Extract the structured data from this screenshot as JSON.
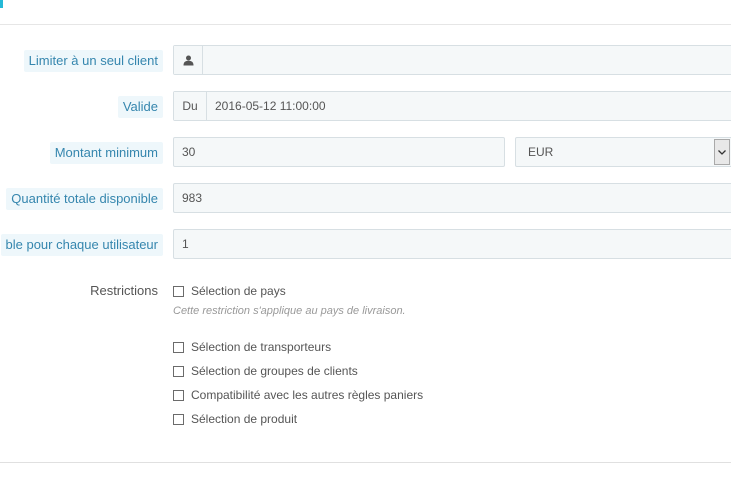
{
  "rows": {
    "customer": {
      "label": "Limiter à un seul client",
      "value": ""
    },
    "valid": {
      "label": "Valide",
      "addon": "Du",
      "value": "2016-05-12 11:00:00"
    },
    "minimum": {
      "label": "Montant minimum",
      "value": "30",
      "currency": "EUR"
    },
    "quantity": {
      "label": "Quantité totale disponible",
      "value": "983"
    },
    "per_user": {
      "label": "ble pour chaque utilisateur",
      "value": "1"
    }
  },
  "restrictions": {
    "label": "Restrictions",
    "items": [
      {
        "label": "Sélection de pays",
        "checked": false
      },
      {
        "label": "Sélection de transporteurs",
        "checked": false
      },
      {
        "label": "Sélection de groupes de clients",
        "checked": false
      },
      {
        "label": "Compatibilité avec les autres règles paniers",
        "checked": false
      },
      {
        "label": "Sélection de produit",
        "checked": false
      }
    ],
    "country_help": "Cette restriction s'applique au pays de livraison."
  },
  "icons": {
    "customer_addon": "user-icon",
    "select_arrow": "chevron-down-icon"
  },
  "colors": {
    "accent": "#25b9d7",
    "label_text": "#3586ae",
    "label_bg": "#eef7fb",
    "input_bg": "#f5f8f9",
    "input_border": "#d7dfe3"
  }
}
